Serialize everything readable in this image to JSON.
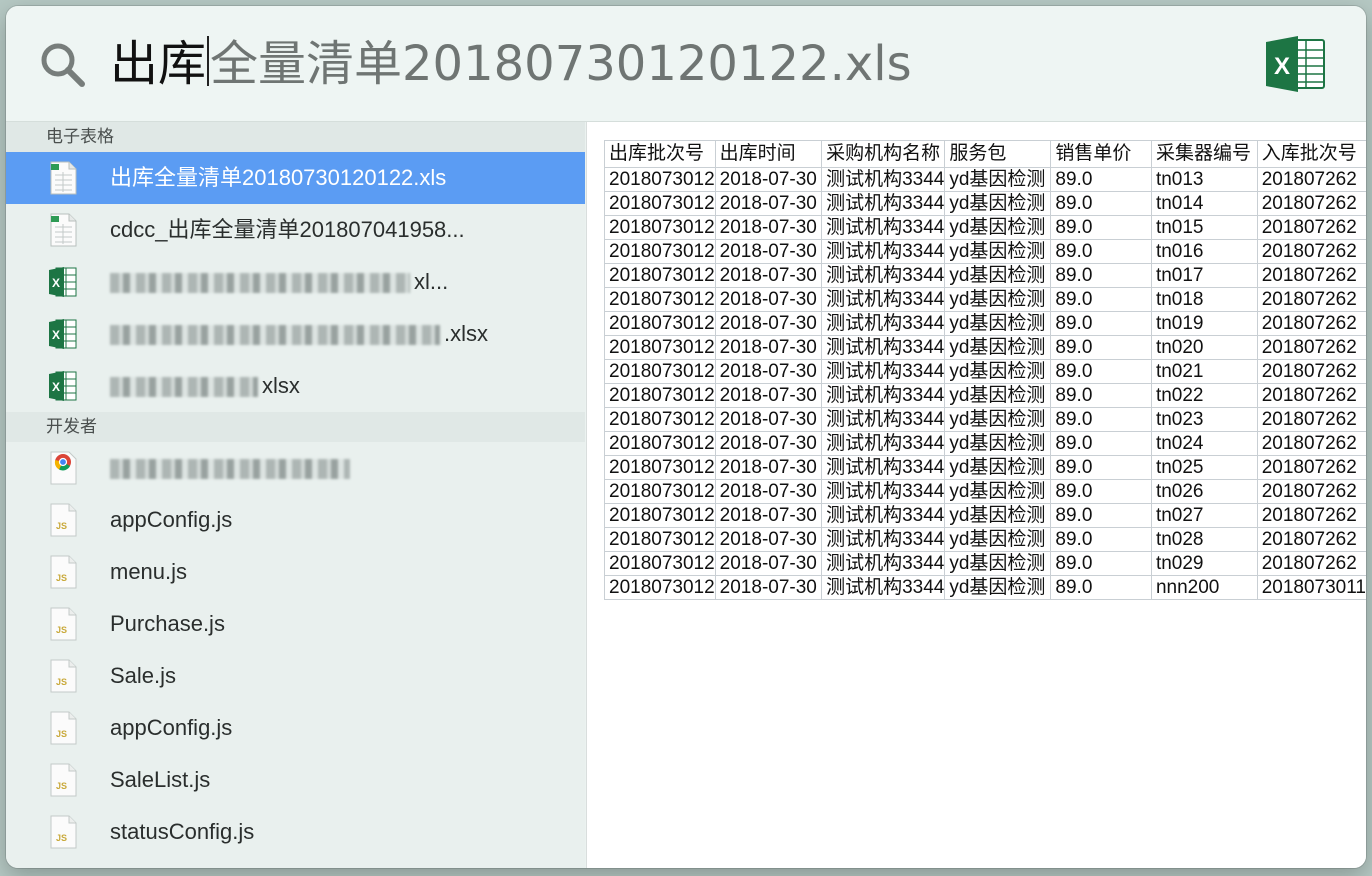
{
  "search": {
    "typed": "出库",
    "completion": "全量清单20180730120122.xls"
  },
  "sections": {
    "spreadsheets": "电子表格",
    "developer": "开发者"
  },
  "spreadsheet_results": [
    {
      "label": "出库全量清单20180730120122.xls",
      "icon": "xls-file-icon",
      "selected": true
    },
    {
      "label": "cdcc_出库全量清单201807041958...",
      "icon": "xls-file-icon"
    },
    {
      "label": "xl...",
      "icon": "excel-file-icon",
      "obscured": true
    },
    {
      "label": ".xlsx",
      "icon": "excel-file-icon",
      "obscured": true
    },
    {
      "label": "xlsx",
      "icon": "excel-file-icon",
      "obscured": true
    }
  ],
  "developer_results": [
    {
      "label": "",
      "icon": "chrome-icon",
      "obscured": true
    },
    {
      "label": "appConfig.js",
      "icon": "js-file-icon"
    },
    {
      "label": "menu.js",
      "icon": "js-file-icon"
    },
    {
      "label": "Purchase.js",
      "icon": "js-file-icon"
    },
    {
      "label": "Sale.js",
      "icon": "js-file-icon"
    },
    {
      "label": "appConfig.js",
      "icon": "js-file-icon"
    },
    {
      "label": "SaleList.js",
      "icon": "js-file-icon"
    },
    {
      "label": "statusConfig.js",
      "icon": "js-file-icon"
    }
  ],
  "colors": {
    "selected_row": "#5b9cf3",
    "excel_green": "#1d7544"
  },
  "preview": {
    "columns": [
      "出库批次号",
      "出库时间",
      "采购机构名称",
      "服务包",
      "销售单价",
      "采集器编号",
      "入库批次号"
    ],
    "rows": [
      [
        "2018073012",
        "2018-07-30",
        "测试机构3344",
        "yd基因检测",
        "89.0",
        "tn013",
        "201807262"
      ],
      [
        "2018073012",
        "2018-07-30",
        "测试机构3344",
        "yd基因检测",
        "89.0",
        "tn014",
        "201807262"
      ],
      [
        "2018073012",
        "2018-07-30",
        "测试机构3344",
        "yd基因检测",
        "89.0",
        "tn015",
        "201807262"
      ],
      [
        "2018073012",
        "2018-07-30",
        "测试机构3344",
        "yd基因检测",
        "89.0",
        "tn016",
        "201807262"
      ],
      [
        "2018073012",
        "2018-07-30",
        "测试机构3344",
        "yd基因检测",
        "89.0",
        "tn017",
        "201807262"
      ],
      [
        "2018073012",
        "2018-07-30",
        "测试机构3344",
        "yd基因检测",
        "89.0",
        "tn018",
        "201807262"
      ],
      [
        "2018073012",
        "2018-07-30",
        "测试机构3344",
        "yd基因检测",
        "89.0",
        "tn019",
        "201807262"
      ],
      [
        "2018073012",
        "2018-07-30",
        "测试机构3344",
        "yd基因检测",
        "89.0",
        "tn020",
        "201807262"
      ],
      [
        "2018073012",
        "2018-07-30",
        "测试机构3344",
        "yd基因检测",
        "89.0",
        "tn021",
        "201807262"
      ],
      [
        "2018073012",
        "2018-07-30",
        "测试机构3344",
        "yd基因检测",
        "89.0",
        "tn022",
        "201807262"
      ],
      [
        "2018073012",
        "2018-07-30",
        "测试机构3344",
        "yd基因检测",
        "89.0",
        "tn023",
        "201807262"
      ],
      [
        "2018073012",
        "2018-07-30",
        "测试机构3344",
        "yd基因检测",
        "89.0",
        "tn024",
        "201807262"
      ],
      [
        "2018073012",
        "2018-07-30",
        "测试机构3344",
        "yd基因检测",
        "89.0",
        "tn025",
        "201807262"
      ],
      [
        "2018073012",
        "2018-07-30",
        "测试机构3344",
        "yd基因检测",
        "89.0",
        "tn026",
        "201807262"
      ],
      [
        "2018073012",
        "2018-07-30",
        "测试机构3344",
        "yd基因检测",
        "89.0",
        "tn027",
        "201807262"
      ],
      [
        "2018073012",
        "2018-07-30",
        "测试机构3344",
        "yd基因检测",
        "89.0",
        "tn028",
        "201807262"
      ],
      [
        "2018073012",
        "2018-07-30",
        "测试机构3344",
        "yd基因检测",
        "89.0",
        "tn029",
        "201807262"
      ],
      [
        "2018073012",
        "2018-07-30",
        "测试机构3344",
        "yd基因检测",
        "89.0",
        "nnn200",
        "2018073011"
      ]
    ]
  }
}
